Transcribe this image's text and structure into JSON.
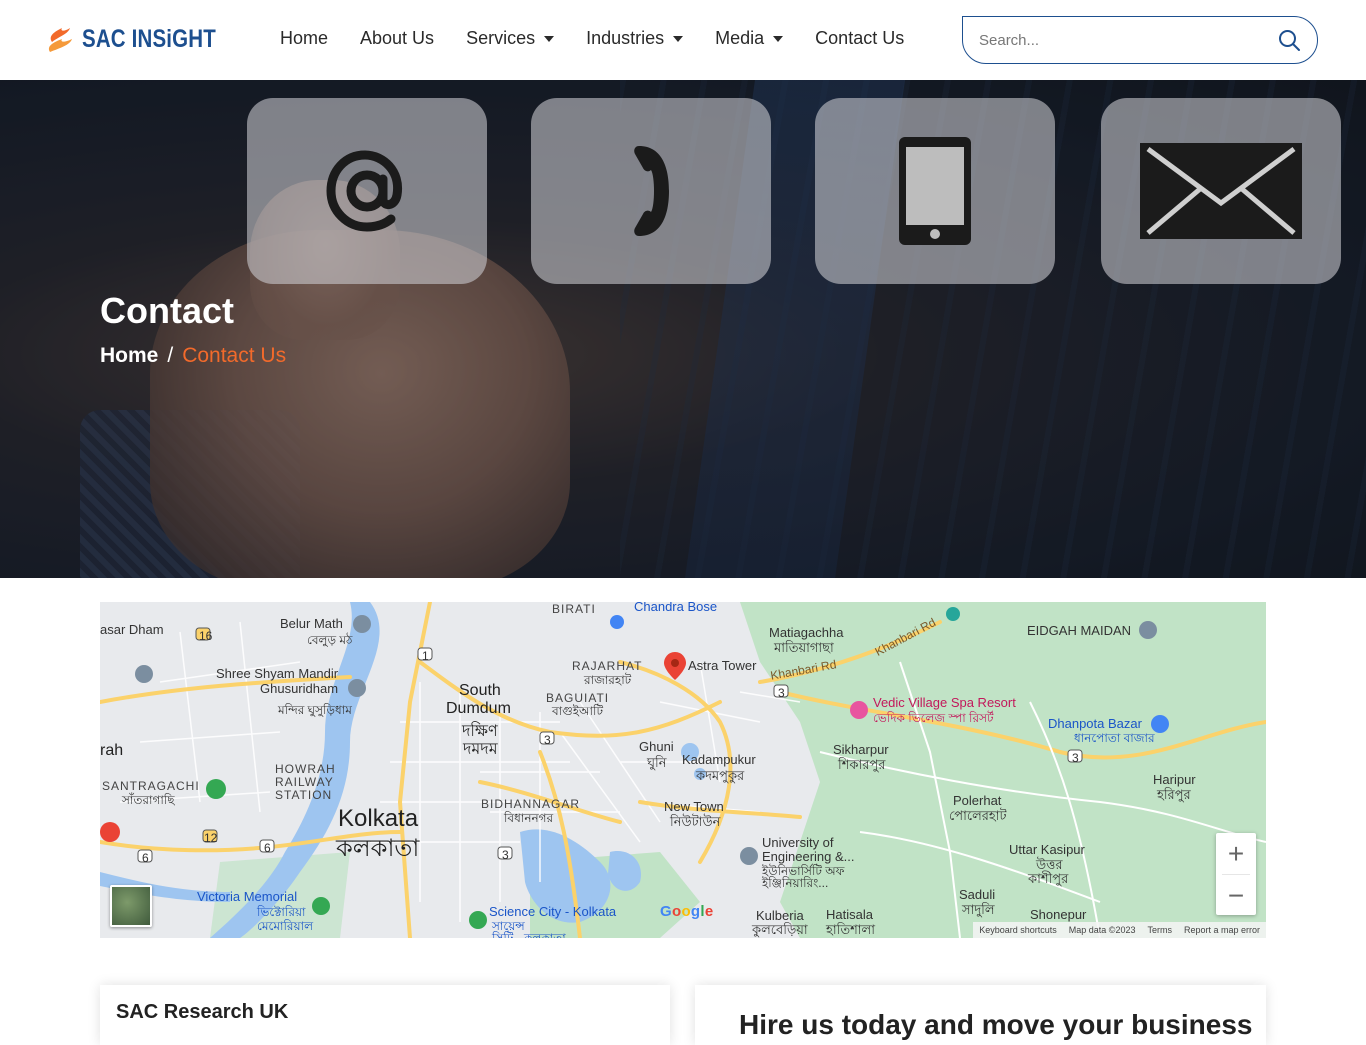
{
  "brand": {
    "name": "SAC INSiGHT",
    "color_primary": "#1d4f8f",
    "color_accent": "#f26a2b"
  },
  "nav": {
    "items": [
      {
        "label": "Home",
        "dropdown": false
      },
      {
        "label": "About Us",
        "dropdown": false
      },
      {
        "label": "Services",
        "dropdown": true
      },
      {
        "label": "Industries",
        "dropdown": true
      },
      {
        "label": "Media",
        "dropdown": true
      },
      {
        "label": "Contact Us",
        "dropdown": false
      }
    ]
  },
  "search": {
    "placeholder": "Search...",
    "value": "",
    "icon": "search-icon"
  },
  "hero": {
    "title": "Contact",
    "breadcrumb": {
      "home": "Home",
      "separator": "/",
      "current": "Contact Us"
    },
    "tiles": [
      "at-sign-icon",
      "phone-icon",
      "mobile-icon",
      "envelope-icon"
    ]
  },
  "map": {
    "labels": {
      "astra_tower": "Astra Tower",
      "kolkata_en": "Kolkata",
      "kolkata_bn": "কলকাতা",
      "south_dumdum_en": "South",
      "south_dumdum_en2": "Dumdum",
      "south_dumdum_bn": "দক্ষিণ",
      "south_dumdum_bn2": "দমদম",
      "rajarhat": "RAJARHAT",
      "rajarhat_bn": "রাজারহাট",
      "baguiati": "BAGUIATI",
      "baguiati_bn": "বাগুইআটি",
      "matiagachha": "Matiagachha",
      "matiagachha_bn": "মাতিয়াগাছা",
      "eidgah_maidan": "EIDGAH MAIDAN",
      "vedic_village": "Vedic Village Spa Resort",
      "vedic_village_bn": "ভেদিক ভিলেজ স্পা রিসর্ট",
      "dhanpota_bazar": "Dhanpota Bazar",
      "dhanpota_bazar_bn": "ধানপোতা বাজার",
      "sikharpur": "Sikharpur",
      "sikharpur_bn": "শিকারপুর",
      "haripur": "Haripur",
      "haripur_bn": "হরিপুর",
      "polerhat": "Polerhat",
      "polerhat_bn": "পোলেরহাট",
      "ghuni": "Ghuni",
      "ghuni_bn": "ঘুনি",
      "kadampukur": "Kadampukur",
      "kadampukur_bn": "কদমপুকুর",
      "new_town": "New Town",
      "new_town_bn": "নিউটাউন",
      "bidhannagar": "BIDHANNAGAR",
      "bidhannagar_bn": "বিধাননগর",
      "howrah_station": "HOWRAH",
      "howrah_station2": "RAILWAY",
      "howrah_station3": "STATION",
      "santragachi": "SANTRAGACHI",
      "santragachi_bn": "সাঁতরাগাছি",
      "belur_math": "Belur Math",
      "belur_math_bn": "বেলুড় মঠ",
      "shree_shyam": "Shree Shyam Mandir",
      "ghusuridham": "Ghusuridham",
      "shree_shyam_bn": "মন্দির ঘুসুড়িধাম",
      "victoria_memorial": "Victoria Memorial",
      "victoria_memorial_bn": "ভিক্টোরিয়া",
      "victoria_memorial_bn2": "মেমোরিয়াল",
      "science_city": "Science City - Kolkata",
      "science_city_bn": "সায়েন্স",
      "science_city_bn2": "সিটি - কলকাতা",
      "university": "University of",
      "university2": "Engineering &...",
      "university_bn": "ইউনিভার্সিটি অফ",
      "university_bn2": "ইঞ্জিনিয়ারিং...",
      "uttar_kasipur": "Uttar Kasipur",
      "uttar_kasipur_bn": "উত্তর",
      "uttar_kasipur_bn2": "কাশীপুর",
      "saduli": "Saduli",
      "saduli_bn": "সাদুলি",
      "shonepur": "Shonepur",
      "kulberia": "Kulberia",
      "kulberia_bn": "কুলবেড়িয়া",
      "hatisala": "Hatisala",
      "hatisala_bn": "হাতিশালা",
      "chandra_bose": "Chandra Bose",
      "birati": "BIRATI",
      "khanbari_rd": "Khanbari Rd",
      "khanbari_rd2": "Khanbari Rd",
      "asar_dham": "asar Dham",
      "rah": "rah",
      "route_16": "16",
      "route_1": "1",
      "route_3a": "3",
      "route_3b": "3",
      "route_3c": "3",
      "route_3d": "3",
      "route_6a": "6",
      "route_6b": "6",
      "route_12": "12"
    },
    "zoom_in": "+",
    "zoom_out": "−",
    "google": "Google",
    "footer": {
      "shortcuts": "Keyboard shortcuts",
      "map_data": "Map data ©2023",
      "terms": "Terms",
      "report": "Report a map error"
    },
    "colors": {
      "land": "#e8eaed",
      "green": "#c1e3c6",
      "water": "#9ec5f0",
      "road_major": "#fbd26b"
    }
  },
  "cards": {
    "left_title": "SAC Research UK",
    "right_heading": "Hire us today and move your business"
  }
}
